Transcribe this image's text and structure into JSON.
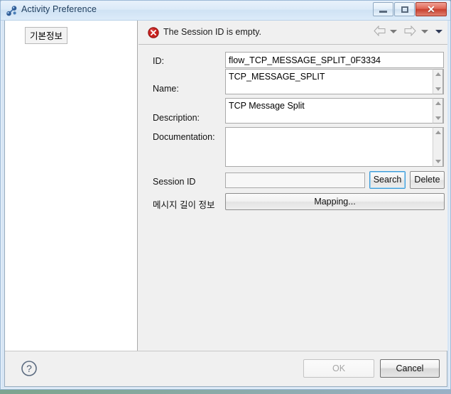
{
  "window": {
    "title": "Activity Preference",
    "icon": "activity-nodes-icon",
    "controls": {
      "minimize": "minimize-icon",
      "maximize": "restore-icon",
      "close": "✕"
    }
  },
  "sidebar": {
    "items": [
      {
        "label": "기본정보",
        "selected": true
      }
    ]
  },
  "message_bar": {
    "icon": "error-icon",
    "text": "The Session ID is empty.",
    "nav": {
      "back": "back-arrow-icon",
      "back_menu": "chevron-down-icon",
      "forward": "forward-arrow-icon",
      "forward_menu": "chevron-down-icon",
      "menu": "chevron-down-icon"
    }
  },
  "form": {
    "id": {
      "label": "ID:",
      "value": "flow_TCP_MESSAGE_SPLIT_0F3334",
      "placeholder": ""
    },
    "name": {
      "label": "Name:",
      "value": "TCP_MESSAGE_SPLIT",
      "placeholder": ""
    },
    "description": {
      "label": "Description:",
      "value": "TCP Message Split",
      "placeholder": ""
    },
    "documentation": {
      "label": "Documentation:",
      "value": "",
      "placeholder": ""
    },
    "session_id": {
      "label": "Session ID",
      "value": "",
      "placeholder": "",
      "search_button": "Search",
      "delete_button": "Delete"
    },
    "message_length": {
      "label": "메시지 길이 정보",
      "mapping_button": "Mapping..."
    }
  },
  "footer": {
    "help_icon": "help-icon",
    "ok_button": "OK",
    "cancel_button": "Cancel"
  },
  "colors": {
    "accent": "#3c9bd9",
    "error": "#cc2222",
    "titlebar": "#dbeaf8",
    "close_button": "#c8402f",
    "panel": "#f0f0f0"
  }
}
